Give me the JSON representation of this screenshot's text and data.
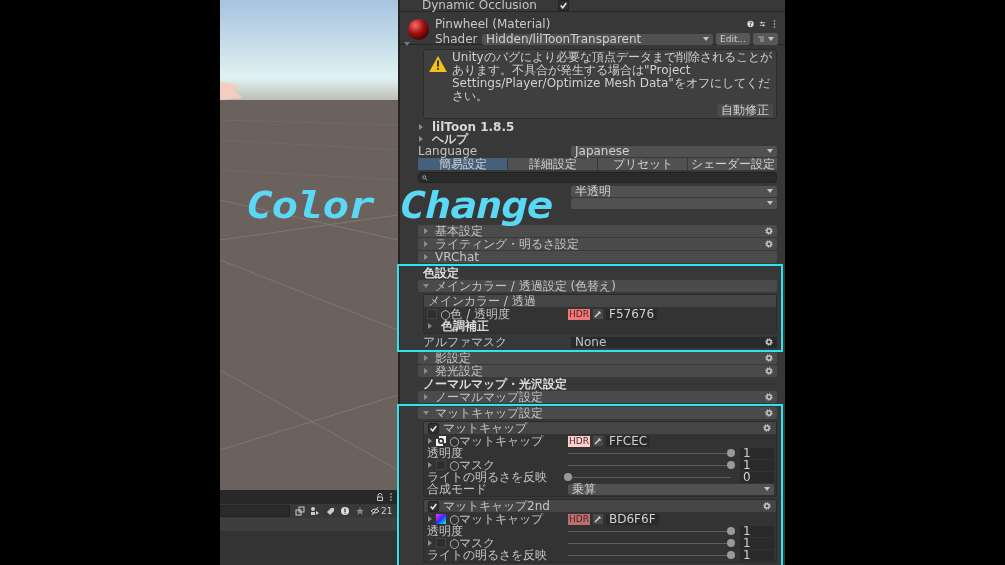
{
  "caption": "Color Change",
  "bottom_panel": {
    "hidden_count": "21"
  },
  "inspector": {
    "top_row": {
      "label": "Dynamic Occlusion",
      "checked": true
    },
    "material": {
      "title": "Pinwheel (Material)",
      "shader_label": "Shader",
      "shader": "Hidden/lilToonTransparent",
      "edit_button": "Edit..."
    },
    "warning": {
      "message": "Unityのバグにより必要な頂点データまで削除されることがあります。不具合が発生する場合は\"Project Settings/Player/Optimize Mesh Data\"をオフにしてください。",
      "fix_button": "自動修正"
    },
    "items": [
      {
        "kind": "foldout",
        "label": "lilToon 1.8.5",
        "expanded": false,
        "highlighted": false
      },
      {
        "kind": "foldout",
        "label": "ヘルプ",
        "expanded": false,
        "highlighted": false
      },
      {
        "kind": "dropdown",
        "label": "Language",
        "value": "Japanese",
        "highlighted": false
      },
      {
        "kind": "tabs",
        "highlighted": false,
        "tabs": [
          {
            "label": "簡易設定",
            "selected": true
          },
          {
            "label": "詳細設定",
            "selected": false
          },
          {
            "label": "プリセット",
            "selected": false
          },
          {
            "label": "シェーダー設定",
            "selected": false
          }
        ]
      },
      {
        "kind": "search",
        "highlighted": false
      },
      {
        "kind": "dropdown",
        "value": "半透明",
        "highlighted": false
      },
      {
        "kind": "dropdown",
        "highlighted": false
      },
      {
        "kind": "spacer",
        "highlighted": false
      },
      {
        "kind": "panel",
        "label": "基本設定",
        "expanded": false,
        "gear": true,
        "highlighted": false
      },
      {
        "kind": "panel",
        "label": "ライティング・明るさ設定",
        "expanded": false,
        "gear": true,
        "highlighted": false
      },
      {
        "kind": "panel",
        "label": "VRChat",
        "expanded": false,
        "gear": false,
        "highlighted": false
      },
      {
        "kind": "heading",
        "label": "色設定",
        "highlighted": true
      },
      {
        "kind": "panel",
        "label": "メインカラー / 透過設定 (色替え)",
        "expanded": true,
        "gear": false,
        "highlighted": true,
        "children": [
          {
            "kind": "group",
            "label": "メインカラー / 透過",
            "children": [
              {
                "kind": "color",
                "label": "○色 / 透明度",
                "texture": {
                  "kind": "none"
                },
                "badge": "HDR",
                "color": "#f57676",
                "value": "F57676"
              },
              {
                "kind": "foldout",
                "label": "色調補正",
                "expanded": false
              }
            ]
          },
          {
            "kind": "texture",
            "label": "アルファマスク",
            "value": "None",
            "gear": true
          }
        ]
      },
      {
        "kind": "panel",
        "label": "影設定",
        "expanded": false,
        "gear": true,
        "highlighted": false
      },
      {
        "kind": "panel",
        "label": "発光設定",
        "expanded": false,
        "gear": true,
        "highlighted": false
      },
      {
        "kind": "heading",
        "label": "ノーマルマップ・光沢設定",
        "highlighted": false
      },
      {
        "kind": "panel",
        "label": "ノーマルマップ設定",
        "expanded": false,
        "gear": true,
        "highlighted": false
      },
      {
        "kind": "panel",
        "label": "マットキャップ設定",
        "expanded": true,
        "gear": true,
        "highlighted": true,
        "children": [
          {
            "kind": "group",
            "label": "マットキャップ",
            "checked": true,
            "gear": true,
            "children": [
              {
                "kind": "color",
                "label": "○マットキャップ",
                "expanded": false,
                "texture": {
                  "kind": "pattern"
                },
                "badge": "HDR",
                "color": "#ffcece",
                "value": "FFCEC"
              },
              {
                "kind": "slider",
                "label": "透明度",
                "level": 1,
                "reading": "1"
              },
              {
                "kind": "slider",
                "label": "○マスク",
                "expanded": false,
                "texture": {
                  "kind": "none"
                },
                "level": 1,
                "reading": "1"
              },
              {
                "kind": "slider",
                "label": "ライトの明るさを反映",
                "level": 0,
                "reading": "0"
              },
              {
                "kind": "dropdown",
                "label": "合成モード",
                "value": "乗算"
              }
            ]
          },
          {
            "kind": "group",
            "label": "マットキャップ2nd",
            "checked": true,
            "gear": true,
            "children": [
              {
                "kind": "color",
                "label": "○マットキャップ",
                "expanded": false,
                "texture": {
                  "kind": "gradient"
                },
                "badge": "HDR",
                "color": "#bd6f6f",
                "value": "BD6F6F"
              },
              {
                "kind": "slider",
                "label": "透明度",
                "level": 1,
                "reading": "1"
              },
              {
                "kind": "slider",
                "label": "○マスク",
                "expanded": false,
                "texture": {
                  "kind": "none"
                },
                "level": 1,
                "reading": "1"
              },
              {
                "kind": "slider",
                "label": "ライトの明るさを反映",
                "level": 1,
                "reading": "1"
              }
            ]
          }
        ]
      }
    ]
  }
}
